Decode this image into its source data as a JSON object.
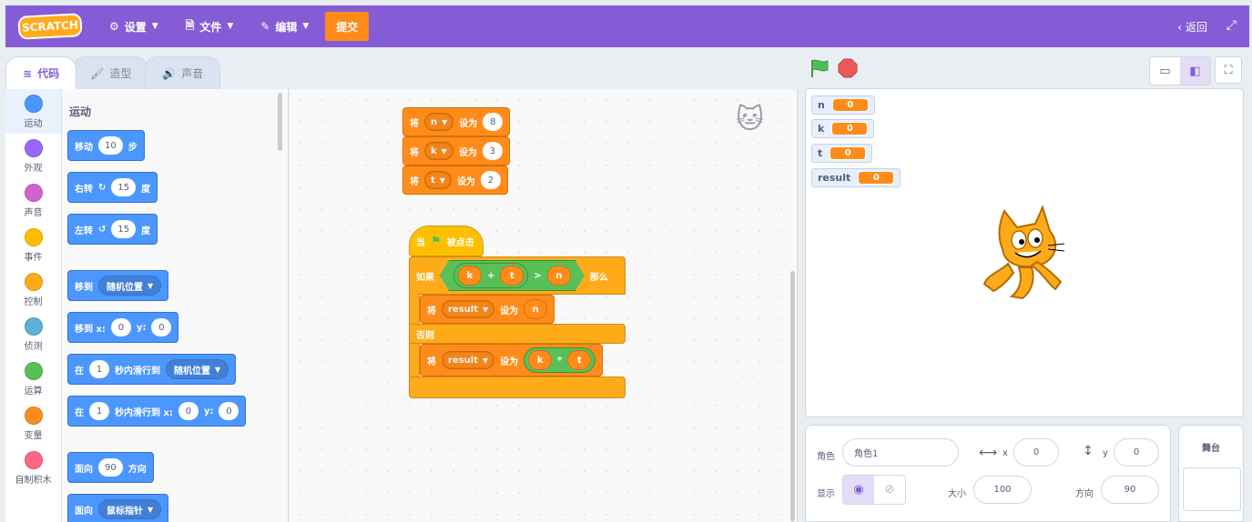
{
  "menu": {
    "logo": "SCRATCH",
    "settings": "设置",
    "file": "文件",
    "edit": "编辑",
    "submit": "提交",
    "back": "返回"
  },
  "tabs": [
    {
      "label": "代码",
      "icon": "code-icon"
    },
    {
      "label": "造型",
      "icon": "brush-icon"
    },
    {
      "label": "声音",
      "icon": "speaker-icon"
    }
  ],
  "categories": [
    {
      "label": "运动",
      "color": "#4c97ff"
    },
    {
      "label": "外观",
      "color": "#9966ff"
    },
    {
      "label": "声音",
      "color": "#cf63cf"
    },
    {
      "label": "事件",
      "color": "#ffbf00"
    },
    {
      "label": "控制",
      "color": "#ffab19"
    },
    {
      "label": "侦测",
      "color": "#5cb1d6"
    },
    {
      "label": "运算",
      "color": "#59c059"
    },
    {
      "label": "变量",
      "color": "#ff8c1a"
    },
    {
      "label": "自制积木",
      "color": "#ff6680"
    }
  ],
  "flyout": {
    "title": "运动",
    "move": {
      "label": "移动",
      "value": "10",
      "unit": "步"
    },
    "turn_right": {
      "label": "右转",
      "value": "15",
      "unit": "度"
    },
    "turn_left": {
      "label": "左转",
      "value": "15",
      "unit": "度"
    },
    "goto": {
      "label": "移到",
      "option": "随机位置"
    },
    "goto_xy": {
      "label": "移到 x:",
      "x": "0",
      "ylabel": "y:",
      "y": "0"
    },
    "glide": {
      "label": "在",
      "value": "1",
      "mid": "秒内滑行到",
      "option": "随机位置"
    },
    "glide_xy": {
      "label": "在",
      "value": "1",
      "mid": "秒内滑行到 x:",
      "x": "0",
      "ylabel": "y:",
      "y": "0"
    },
    "point": {
      "label": "面向",
      "value": "90",
      "unit": "方向"
    },
    "point_toward": {
      "label": "面向",
      "option": "鼠标指针"
    }
  },
  "script": {
    "set_n": {
      "label": "将",
      "var": "n",
      "to": "设为",
      "value": "8"
    },
    "set_k": {
      "label": "将",
      "var": "k",
      "to": "设为",
      "value": "3"
    },
    "set_t": {
      "label": "将",
      "var": "t",
      "to": "设为",
      "value": "2"
    },
    "hat": {
      "when": "当",
      "clicked": "被点击"
    },
    "if": {
      "label": "如果",
      "then": "那么",
      "a": "k",
      "plus": "+",
      "b": "t",
      "gt": ">",
      "c": "n"
    },
    "set_result_n": {
      "label": "将",
      "var": "result",
      "to": "设为",
      "value": "n"
    },
    "else": "否则",
    "set_result_kt": {
      "label": "将",
      "var": "result",
      "to": "设为",
      "a": "k",
      "op": "*",
      "b": "t"
    }
  },
  "monitors": [
    {
      "name": "n",
      "value": "0"
    },
    {
      "name": "k",
      "value": "0"
    },
    {
      "name": "t",
      "value": "0"
    },
    {
      "name": "result",
      "value": "0"
    }
  ],
  "sprite_info": {
    "sprite_label": "角色",
    "sprite_name": "角色1",
    "x_label": "x",
    "x": "0",
    "y_label": "y",
    "y": "0",
    "show_label": "显示",
    "size_label": "大小",
    "size": "100",
    "direction_label": "方向",
    "direction": "90"
  },
  "stage_pane": {
    "title": "舞台"
  }
}
